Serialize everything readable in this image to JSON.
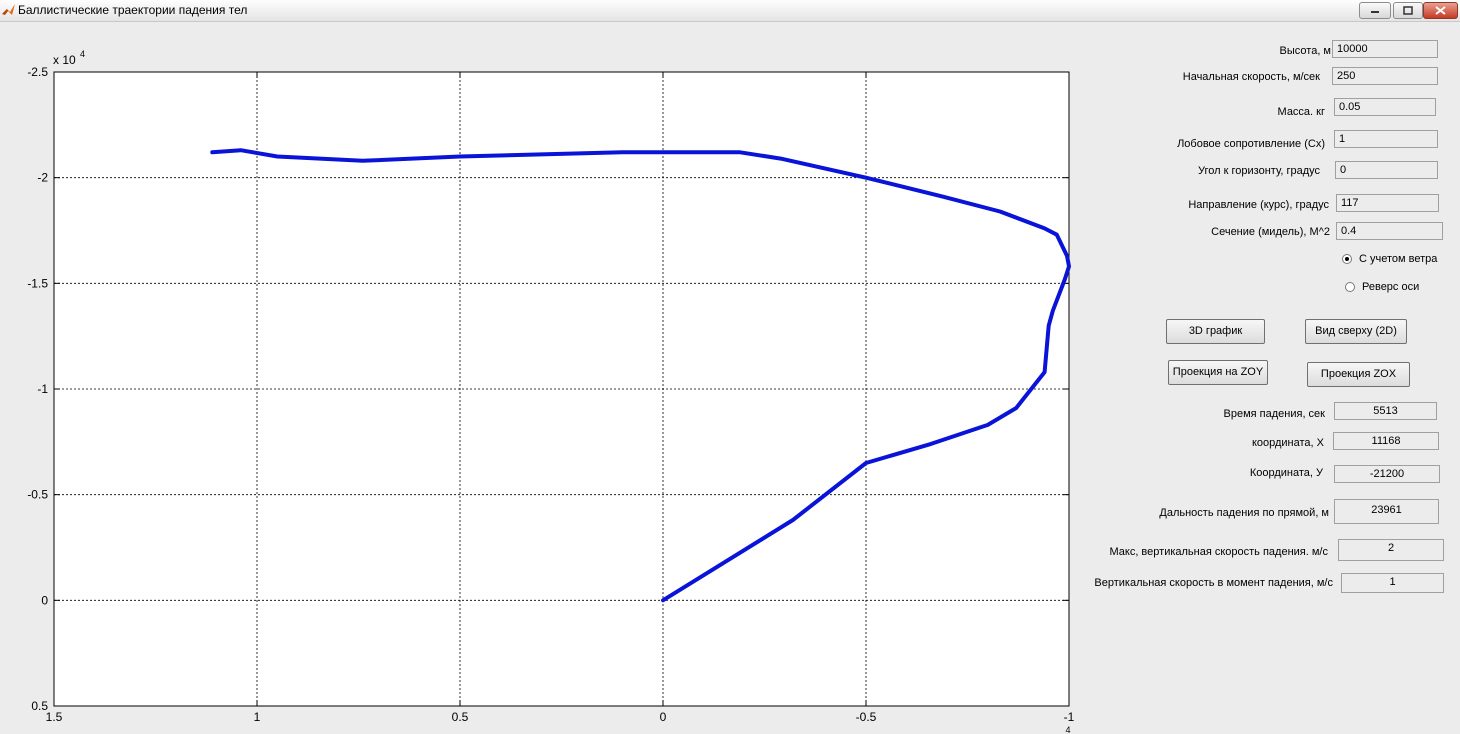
{
  "window": {
    "title": "Баллистические траектории падения тел",
    "icon": "matlab-logo-icon"
  },
  "controls": {
    "height_label": "Высота, м",
    "height_value": "10000",
    "speed_label": "Начальная скорость, м/сек",
    "speed_value": "250",
    "mass_label": "Масса. кг",
    "mass_value": "0.05",
    "drag_label": "Лобовое сопротивление (Cx)",
    "drag_value": "1",
    "angle_label": "Угол к горизонту, градус",
    "angle_value": "0",
    "course_label": "Направление  (курс), градус",
    "course_value": "117",
    "section_label": "Сечение (мидель), М^2",
    "section_value": "0.4",
    "wind_label": "С учетом ветра",
    "wind_checked": true,
    "reverse_label": "Реверс оси",
    "reverse_checked": false
  },
  "buttons": {
    "plot3d": "3D график",
    "topview": "Вид сверху (2D)",
    "zoy": "Проекция на ZOY",
    "zox": "Проекция ZOX"
  },
  "results": {
    "time_label": "Время падения, сек",
    "time_value": "5513",
    "x_label": "координата, X",
    "x_value": "11168",
    "y_label": "Координата, У",
    "y_value": "-21200",
    "range_label": "Дальность падения по прямой, м",
    "range_value": "23961",
    "maxv_label": "Макс,  вертикальная скорость падения. м/с",
    "maxv_value": "2",
    "impactv_label": "Вертикальная  скорость в момент падения, м/с",
    "impactv_value": "1"
  },
  "chart_data": {
    "type": "line",
    "x_multiplier_label": "4",
    "y_multiplier_label": "x 10",
    "y_multiplier_exp": "4",
    "xlim": [
      1.5,
      -1
    ],
    "ylim": [
      0.5,
      -2.5
    ],
    "x_reversed": true,
    "y_reversed": true,
    "grid": true,
    "xticks": [
      "1.5",
      "1",
      "0.5",
      "0",
      "-0.5",
      "-1"
    ],
    "xtick_values": [
      1.5,
      1,
      0.5,
      0,
      -0.5,
      -1
    ],
    "yticks": [
      "-2.5",
      "-2",
      "-1.5",
      "-1",
      "-0.5",
      "0",
      "0.5"
    ],
    "ytick_values": [
      -2.5,
      -2,
      -1.5,
      -1,
      -0.5,
      0,
      0.5
    ],
    "line_color": "#0a14d8",
    "series": [
      {
        "x": [
          0,
          -0.32,
          -0.5,
          -0.66,
          -0.8,
          -0.87,
          -0.94,
          -0.95,
          -0.96,
          -0.99,
          -1.0,
          -0.995,
          -0.97,
          -0.94,
          -0.83,
          -0.69,
          -0.5,
          -0.29,
          -0.19,
          0.1,
          0.5,
          0.74,
          0.95,
          1.04,
          1.11
        ],
        "y": [
          0,
          -0.38,
          -0.65,
          -0.74,
          -0.83,
          -0.91,
          -1.08,
          -1.3,
          -1.37,
          -1.52,
          -1.58,
          -1.63,
          -1.73,
          -1.76,
          -1.84,
          -1.91,
          -2.0,
          -2.09,
          -2.12,
          -2.12,
          -2.1,
          -2.08,
          -2.1,
          -2.13,
          -2.12
        ]
      }
    ]
  }
}
